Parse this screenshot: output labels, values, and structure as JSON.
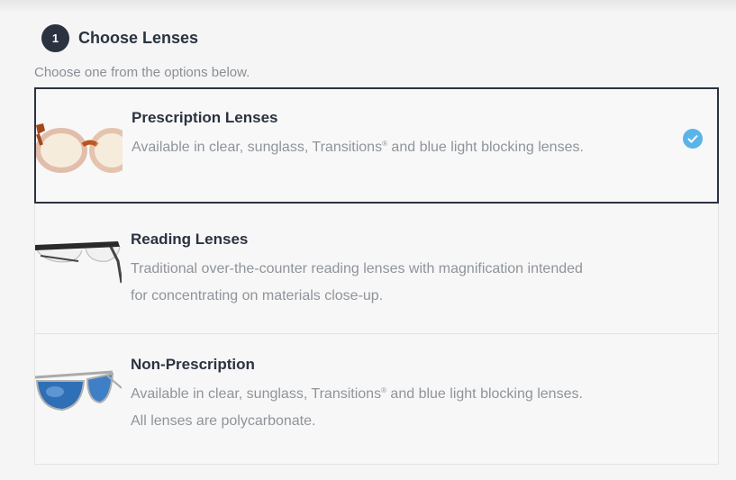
{
  "step": {
    "number": "1",
    "title": "Choose Lenses"
  },
  "instructions": "Choose one from the options below.",
  "options": [
    {
      "title": "Prescription Lenses",
      "desc_line1_pre": "Available in clear, sunglass, Transitions",
      "desc_line1_sup": "®",
      "desc_line1_post": " and blue light blocking lenses.",
      "selected": true,
      "image": "tortoise-round-glasses"
    },
    {
      "title": "Reading Lenses",
      "desc_line1": "Traditional over-the-counter reading lenses with magnification intended",
      "desc_line2": "for concentrating on materials close-up.",
      "selected": false,
      "image": "black-half-rim-glasses"
    },
    {
      "title": "Non-Prescription",
      "desc_line1_pre": "Available in clear, sunglass, Transitions",
      "desc_line1_sup": "®",
      "desc_line1_post": " and blue light blocking lenses.",
      "desc_line2": "All lenses are polycarbonate.",
      "selected": false,
      "image": "blue-mirror-aviator-sunglasses"
    }
  ],
  "colors": {
    "accent": "#5ab4e8",
    "dark": "#2b3240",
    "muted": "#8f949a"
  }
}
